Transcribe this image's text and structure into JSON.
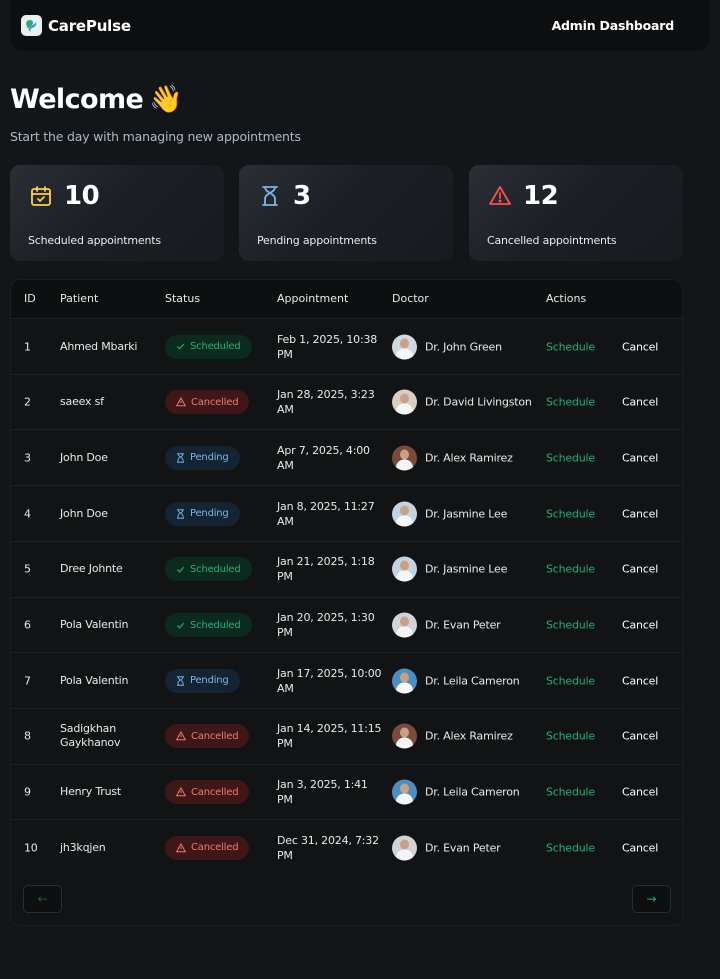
{
  "header": {
    "brand": "CarePulse",
    "admin_label": "Admin Dashboard"
  },
  "welcome": {
    "title": "Welcome",
    "emoji": "👋",
    "subtitle": "Start the day with managing new appointments"
  },
  "stats": [
    {
      "count": "10",
      "label": "Scheduled appointments",
      "icon": "calendar-check-icon",
      "color": "#ffd147"
    },
    {
      "count": "3",
      "label": "Pending appointments",
      "icon": "hourglass-icon",
      "color": "#79b5ec"
    },
    {
      "count": "12",
      "label": "Cancelled appointments",
      "icon": "warning-icon",
      "color": "#ff4f4e"
    }
  ],
  "table": {
    "headers": [
      "ID",
      "Patient",
      "Status",
      "Appointment",
      "Doctor",
      "Actions"
    ],
    "action_schedule": "Schedule",
    "action_cancel": "Cancel",
    "rows": [
      {
        "id": "1",
        "patient": "Ahmed Mbarki",
        "status": "Scheduled",
        "appointment": "Feb 1, 2025, 10:38 PM",
        "doctor": "Dr. John Green",
        "avatar_bg": "#cfd8df"
      },
      {
        "id": "2",
        "patient": "saeex sf",
        "status": "Cancelled",
        "appointment": "Jan 28, 2025, 3:23 AM",
        "doctor": "Dr. David Livingston",
        "avatar_bg": "#d8cfc3"
      },
      {
        "id": "3",
        "patient": "John Doe",
        "status": "Pending",
        "appointment": "Apr 7, 2025, 4:00 AM",
        "doctor": "Dr. Alex Ramirez",
        "avatar_bg": "#7a4a3a"
      },
      {
        "id": "4",
        "patient": "John Doe",
        "status": "Pending",
        "appointment": "Jan 8, 2025, 11:27 AM",
        "doctor": "Dr. Jasmine Lee",
        "avatar_bg": "#c4d3e0"
      },
      {
        "id": "5",
        "patient": "Dree Johnte",
        "status": "Scheduled",
        "appointment": "Jan 21, 2025, 1:18 PM",
        "doctor": "Dr. Jasmine Lee",
        "avatar_bg": "#c4d3e0"
      },
      {
        "id": "6",
        "patient": "Pola Valentin",
        "status": "Scheduled",
        "appointment": "Jan 20, 2025, 1:30 PM",
        "doctor": "Dr. Evan Peter",
        "avatar_bg": "#d0d3da"
      },
      {
        "id": "7",
        "patient": "Pola Valentin",
        "status": "Pending",
        "appointment": "Jan 17, 2025, 10:00 AM",
        "doctor": "Dr. Leila Cameron",
        "avatar_bg": "#4a8fc0"
      },
      {
        "id": "8",
        "patient": "Sadigkhan Gaykhanov",
        "status": "Cancelled",
        "appointment": "Jan 14, 2025, 11:15 PM",
        "doctor": "Dr. Alex Ramirez",
        "avatar_bg": "#7a4a3a"
      },
      {
        "id": "9",
        "patient": "Henry Trust",
        "status": "Cancelled",
        "appointment": "Jan 3, 2025, 1:41 PM",
        "doctor": "Dr. Leila Cameron",
        "avatar_bg": "#4a8fc0"
      },
      {
        "id": "10",
        "patient": "jh3kqjen",
        "status": "Cancelled",
        "appointment": "Dec 31, 2024, 7:32 PM",
        "doctor": "Dr. Evan Peter",
        "avatar_bg": "#d0d3da"
      }
    ]
  },
  "pagination": {
    "prev_icon": "arrow-left-icon",
    "next_icon": "arrow-right-icon",
    "prev_glyph": "←",
    "next_glyph": "→"
  }
}
